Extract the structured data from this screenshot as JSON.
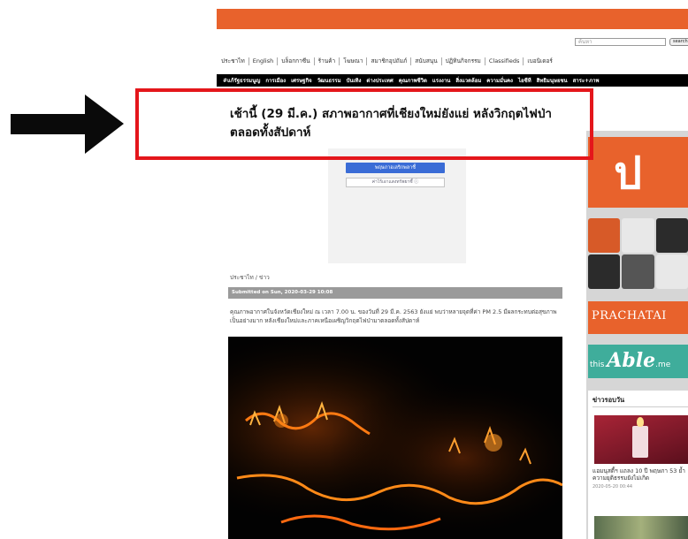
{
  "header": {
    "search": {
      "placeholder": "ค้นหา",
      "button_label": "search"
    },
    "main_nav": [
      "ประชาไท",
      "English",
      "บล็อกกาซีน",
      "ร้านค้า",
      "โฆษณา",
      "สมาชิกอุปถัมภ์",
      "สนับสนุน",
      "ปฏิทินกิจกรรม",
      "Classifieds",
      "เบอนิเดอร์"
    ],
    "sub_nav": [
      "#แก้รัฐธรรมนูญ",
      "การเมือง",
      "เศรษฐกิจ",
      "วัฒนธรรม",
      "บันเทิง",
      "ต่างประเทศ",
      "คุณภาพชีวิต",
      "แรงงาน",
      "สิ่งแวดล้อม",
      "ความมั่นคง",
      "ไอซีที",
      "สิทธิมนุษยชน",
      "สาระ+ภาพ"
    ]
  },
  "article": {
    "title": "เช้านี้ (29 มี.ค.) สภาพอากาศที่เชียงใหม่ยังแย่ หลังวิกฤตไฟป่าตลอดทั้งสัปดาห์",
    "share_primary": "พฤษภาอเลริกพลาชี้",
    "share_secondary": "ค่าไร้เอาแสงทรัพยาชี้ ⓘ",
    "breadcrumb": "ประชาไท / ข่าว",
    "submitted": "Submitted on Sun, 2020-03-29 10:08",
    "summary": "คุณภาพอากาศในจังหวัดเชียงใหม่ ณ เวลา 7.00 น. ของวันที่ 29 มี.ค. 2563 ยังแย่ พบว่าหลายจุดที่ค่า PM 2.5 มีผลกระทบต่อสุขภาพเป็นอย่างมาก หลังเชียงใหม่และภาคเหนือเผชิญวิกฤตไฟป่ามาตลอดทั้งสัปดาห์"
  },
  "sidebar": {
    "logo_glyph": "ป",
    "brand": "PRACHATAI",
    "able": {
      "prefix": "this ",
      "mark": "Able",
      "suffix": ".me"
    },
    "section_heading": "ข่าวรอบวัน",
    "news_item": {
      "text": "แอมนุสตี้ฯ แถลง 10 ปี พฤษภา 53 ย้ำความยุติธรรมยังไม่เกิด",
      "date": "2020-05-20 00:44"
    }
  },
  "colors": {
    "brand_orange": "#e8622c",
    "highlight_red": "#e4161b",
    "able_teal": "#3fad9b"
  },
  "icons": {
    "annotation": "right-arrow-icon"
  }
}
